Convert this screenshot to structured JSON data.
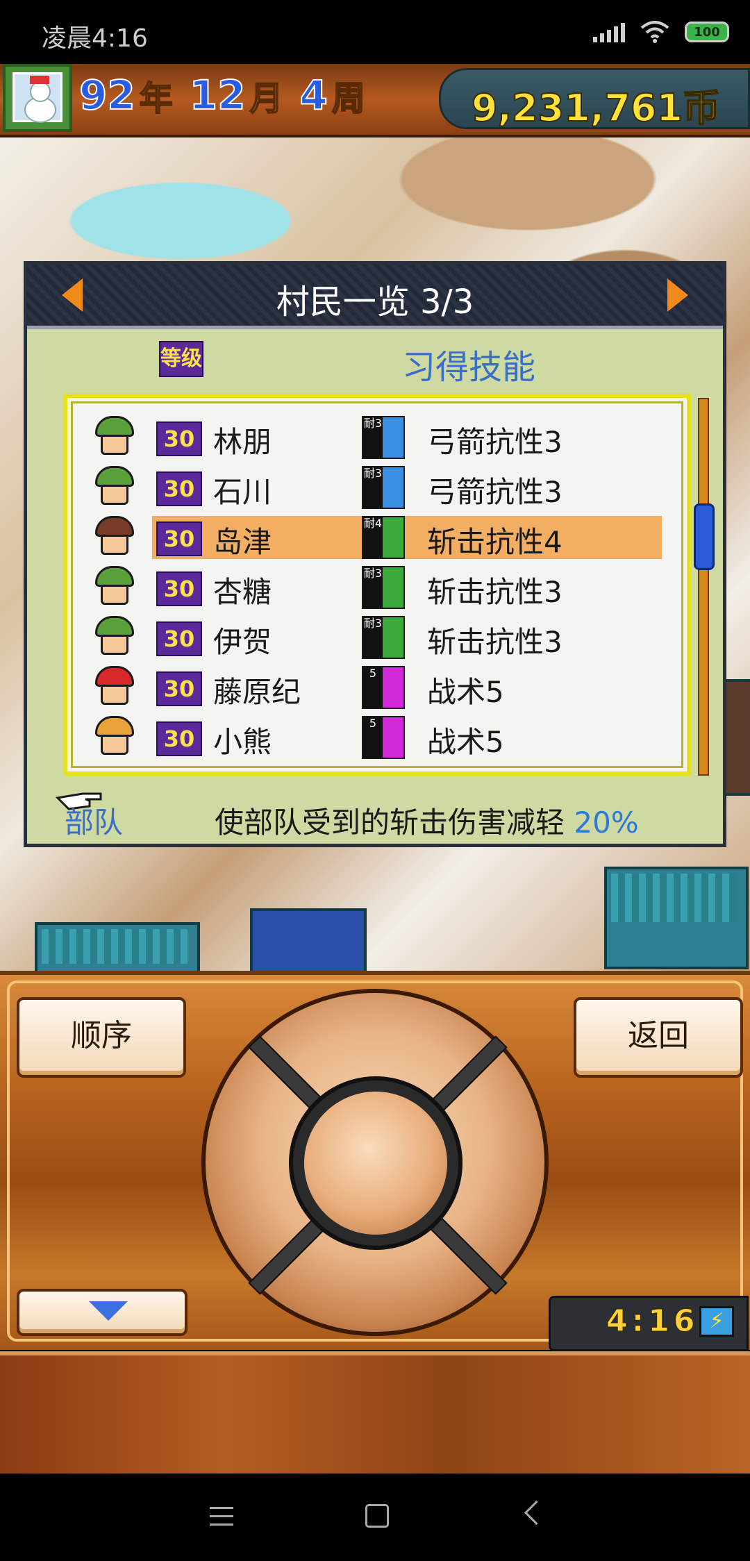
{
  "status_bar": {
    "time": "凌晨4:16",
    "battery": "100"
  },
  "hud": {
    "year": "92",
    "year_unit": "年",
    "month": "12",
    "month_unit": "月",
    "week": "4",
    "week_unit": "周",
    "money": "9,231,761币"
  },
  "panel": {
    "title": "村民一览 3/3",
    "level_header": "等级",
    "skill_header": "习得技能",
    "rows": [
      {
        "level": "30",
        "name": "林朋",
        "skill": "弓箭抗性3",
        "skill_tag": "耐3",
        "skill_color": "#3a8fe0",
        "hair": "#5aa03a"
      },
      {
        "level": "30",
        "name": "石川",
        "skill": "弓箭抗性3",
        "skill_tag": "耐3",
        "skill_color": "#3a8fe0",
        "hair": "#5aa03a"
      },
      {
        "level": "30",
        "name": "岛津",
        "skill": "斩击抗性4",
        "skill_tag": "耐4",
        "skill_color": "#3aa83a",
        "hair": "#7a3a2a"
      },
      {
        "level": "30",
        "name": "杏糖",
        "skill": "斩击抗性3",
        "skill_tag": "耐3",
        "skill_color": "#3aa83a",
        "hair": "#5aa03a"
      },
      {
        "level": "30",
        "name": "伊贺",
        "skill": "斩击抗性3",
        "skill_tag": "耐3",
        "skill_color": "#3aa83a",
        "hair": "#5aa03a"
      },
      {
        "level": "30",
        "name": "藤原纪",
        "skill": "战术5",
        "skill_tag": "5",
        "skill_color": "#d02ad8",
        "hair": "#d8282a"
      },
      {
        "level": "30",
        "name": "小熊",
        "skill": "战术5",
        "skill_tag": "5",
        "skill_color": "#d02ad8",
        "hair": "#e8a23a"
      }
    ],
    "selected_index": 2,
    "desc_left": "部队",
    "desc_text": "使部队受到的斩击伤害减轻 ",
    "desc_pct": "20%"
  },
  "controls": {
    "order_label": "顺序",
    "back_label": "返回",
    "clock": "4:16"
  },
  "colors": {
    "accent_orange": "#f08a1a",
    "highlight": "#f2ae62",
    "level_bg": "#5a2a9a"
  }
}
